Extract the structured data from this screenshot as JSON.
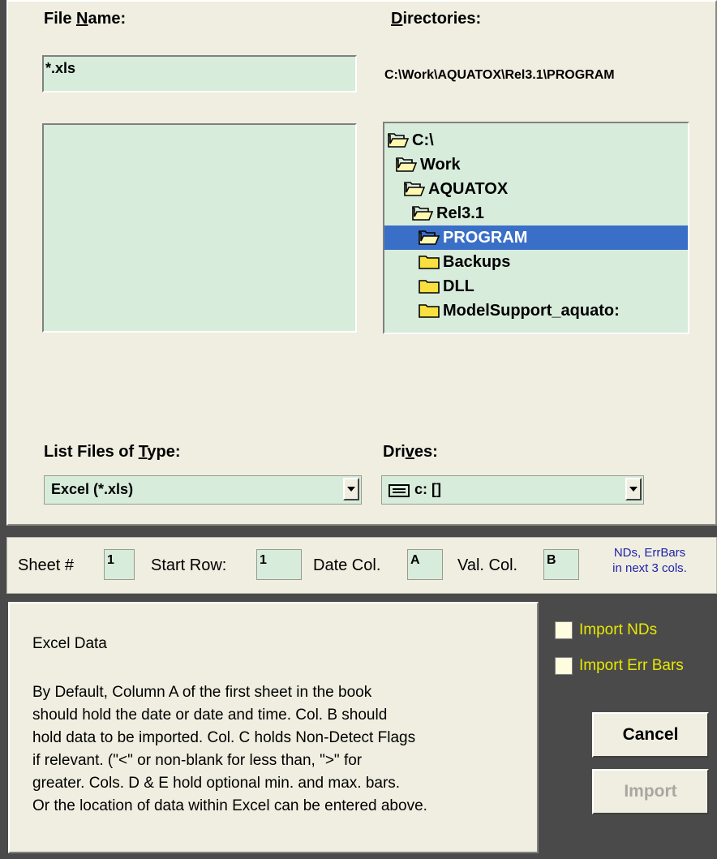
{
  "file_name": {
    "label": "File Name:",
    "value": "*.xls"
  },
  "directories": {
    "label": "Directories:",
    "path": "C:\\Work\\AQUATOX\\Rel3.1\\PROGRAM",
    "tree": [
      {
        "name": "C:\\",
        "icon": "open-folder-icon"
      },
      {
        "name": "Work",
        "icon": "open-folder-icon"
      },
      {
        "name": "AQUATOX",
        "icon": "open-folder-icon"
      },
      {
        "name": "Rel3.1",
        "icon": "open-folder-icon"
      },
      {
        "name": "PROGRAM",
        "icon": "open-folder-icon",
        "selected": true
      },
      {
        "name": "Backups",
        "icon": "closed-folder-icon"
      },
      {
        "name": "DLL",
        "icon": "closed-folder-icon"
      },
      {
        "name": "ModelSupport_aquato:",
        "icon": "closed-folder-icon"
      }
    ]
  },
  "file_type": {
    "label": "List Files of Type:",
    "value": "Excel (*.xls)"
  },
  "drives": {
    "label": "Drives:",
    "value": "c: []"
  },
  "sheet": {
    "sheet_label": "Sheet #",
    "sheet_value": "1",
    "start_row_label": "Start Row:",
    "start_row_value": "1",
    "date_col_label": "Date Col.",
    "date_col_value": "A",
    "val_col_label": "Val. Col.",
    "val_col_value": "B",
    "note_line1": "NDs, ErrBars",
    "note_line2": "in next 3 cols."
  },
  "description": {
    "title": "Excel Data",
    "lines": [
      "By Default, Column A of the first sheet in the book",
      "should hold the date or date and time. Col. B should",
      "hold data to be imported.  Col. C holds Non-Detect Flags",
      "if relevant. (\"<\" or non-blank for less than, \">\" for",
      "greater. Cols. D & E hold optional min. and max. bars.",
      "Or the location of data within Excel can be entered above."
    ]
  },
  "options": {
    "import_nds": "Import NDs",
    "import_err_bars": "Import Err Bars"
  },
  "buttons": {
    "cancel": "Cancel",
    "import": "Import"
  },
  "colors": {
    "panel": "#efeee1",
    "field": "#d8ecdc",
    "selection": "#3a6fc8",
    "checkbox_text": "#e8e800",
    "note_text": "#2222aa"
  }
}
